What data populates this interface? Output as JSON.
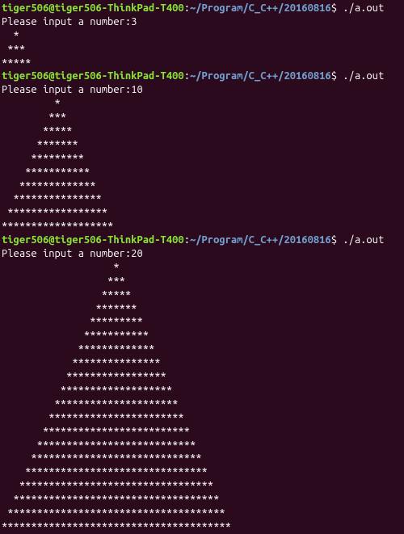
{
  "prompt": {
    "user_host": "tiger506@tiger506-ThinkPad-T400",
    "separator": ":",
    "path": "~/Program/C_C++/20160816",
    "dollar": "$ "
  },
  "runs": [
    {
      "command": "./a.out",
      "input_prompt": "Please input a number:",
      "input_value": "3",
      "pyramid_rows": 3
    },
    {
      "command": "./a.out",
      "input_prompt": "Please input a number:",
      "input_value": "10",
      "pyramid_rows": 10
    },
    {
      "command": "./a.out",
      "input_prompt": "Please input a number:",
      "input_value": "20",
      "pyramid_rows": 20
    }
  ]
}
